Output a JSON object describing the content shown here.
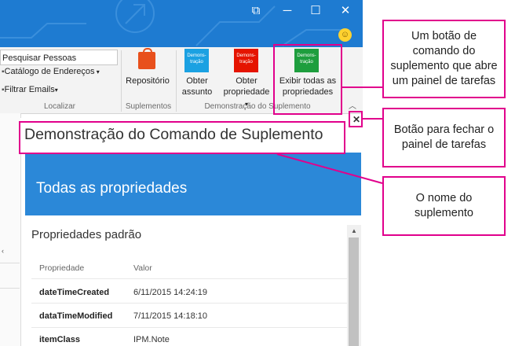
{
  "ribbon": {
    "search_people": "Pesquisar Pessoas",
    "address_book": "Catálogo de Endereços",
    "filter_email": "Filtrar Emails",
    "group_find": "Localizar",
    "store_label": "Repositório",
    "group_addins": "Suplementos",
    "get_subject": [
      "Obter",
      "assunto"
    ],
    "get_properties": [
      "Obter",
      "propriedade"
    ],
    "show_all": [
      "Exibir todas as",
      "propriedades"
    ],
    "group_demo": "Demonstração do Suplemento",
    "icon_text": [
      "Demons-",
      "tração"
    ]
  },
  "task_pane": {
    "addin_name": "Demonstração do Comando de Suplemento",
    "header": "Todas as propriedades",
    "subheader": "Propriedades padrão",
    "col_property": "Propriedade",
    "col_value": "Valor",
    "rows": [
      {
        "key": "dateTimeCreated",
        "value": "6/11/2015 14:24:19"
      },
      {
        "key": "dataTimeModified",
        "value": "7/11/2015 14:18:10"
      },
      {
        "key": "itemClass",
        "value": "IPM.Note"
      }
    ]
  },
  "callouts": {
    "command_button": "Um botão de comando do suplemento que abre um painel de tarefas",
    "close_button": "Botão para fechar o painel de tarefas",
    "addin_name": "O nome do suplemento"
  },
  "colors": {
    "titlebar": "#1e7bd1",
    "task_header": "#2b88d8",
    "highlight": "#e1008c",
    "icon_blue": "#1ba1e2",
    "icon_red": "#e51400",
    "icon_green": "#1e9e3e",
    "store_orange": "#e8501c"
  },
  "icons": [
    "smiley-icon",
    "restore-icon",
    "minimize-icon",
    "maximize-icon",
    "close-icon",
    "store-icon",
    "dropdown-icon",
    "close-pane-icon"
  ]
}
